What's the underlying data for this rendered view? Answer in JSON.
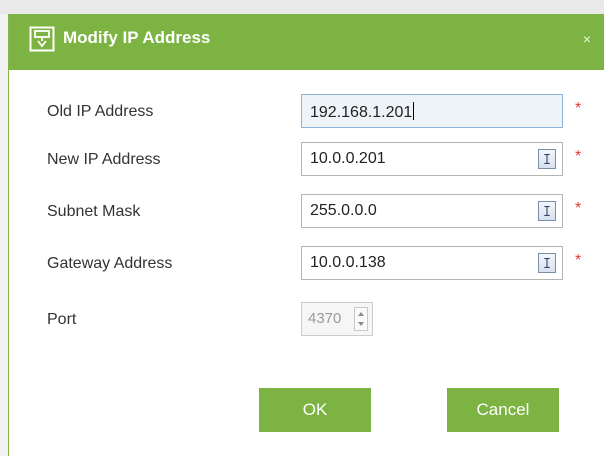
{
  "dialog": {
    "title": "Modify IP Address",
    "close_glyph": "×",
    "title_icon": "network-config-icon"
  },
  "fields": {
    "old_ip": {
      "label": "Old IP Address",
      "value": "192.168.1.201",
      "required": "*"
    },
    "new_ip": {
      "label": "New IP Address",
      "value": "10.0.0.201",
      "required": "*",
      "icon": "ip-address-icon"
    },
    "subnet": {
      "label": "Subnet Mask",
      "value": "255.0.0.0",
      "required": "*",
      "icon": "ip-address-icon"
    },
    "gateway": {
      "label": "Gateway Address",
      "value": "10.0.0.138",
      "required": "*",
      "icon": "ip-address-icon"
    },
    "port": {
      "label": "Port",
      "value": "4370"
    }
  },
  "buttons": {
    "ok_label": "OK",
    "cancel_label": "Cancel"
  },
  "colors": {
    "accent": "#7cb342",
    "required": "#e53935",
    "focused_field_bg": "#eef3f8"
  }
}
